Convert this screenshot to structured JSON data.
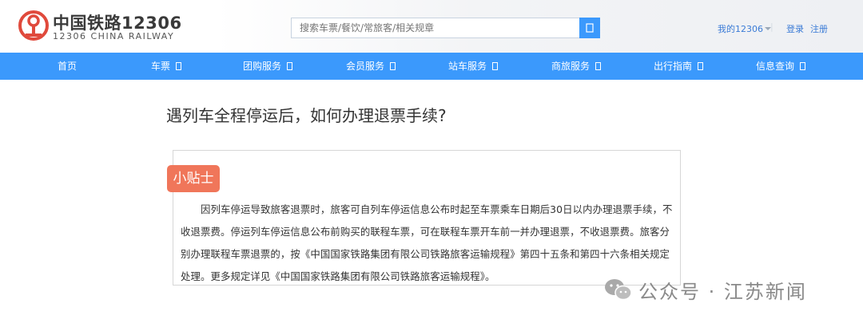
{
  "header": {
    "brand_cn": "中国铁路12306",
    "brand_en": "12306 CHINA RAILWAY",
    "logo_icon": "railway-logo-icon",
    "accent_color": "#e04a3c"
  },
  "search": {
    "placeholder": "搜索车票/餐饮/常旅客/相关规章",
    "button_icon": "search-icon"
  },
  "user_links": {
    "my_account": "我的12306",
    "login": "登录",
    "register": "注册"
  },
  "nav": {
    "items": [
      "首页",
      "车票",
      "团购服务",
      "会员服务",
      "站车服务",
      "商旅服务",
      "出行指南",
      "信息查询"
    ],
    "color": "#3b99fc"
  },
  "article": {
    "question": "遇列车全程停运后，如何办理退票手续?",
    "tip_label": "小贴士",
    "tip_color": "#f0765a",
    "tip_body": "因列车停运导致旅客退票时，旅客可自列车停运信息公布时起至车票乘车日期后30日以内办理退票手续，不收退票费。停运列车停运信息公布前购买的联程车票，可在联程车票开车前一并办理退票，不收退票费。旅客分别办理联程车票退票的，按《中国国家铁路集团有限公司铁路旅客运输规程》第四十五条和第四十六条相关规定处理。更多规定详见《中国国家铁路集团有限公司铁路旅客运输规程》。"
  },
  "watermark": {
    "text": "公众号 · 江苏新闻",
    "icon": "wechat-icon"
  }
}
